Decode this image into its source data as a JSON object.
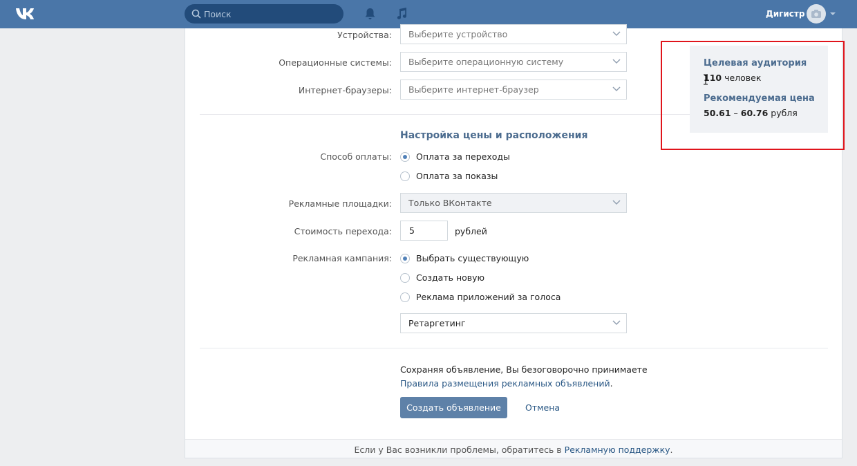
{
  "header": {
    "search_placeholder": "Поиск",
    "username": "Дигистр",
    "icons": [
      "vk-logo-icon",
      "search-icon",
      "bell-icon",
      "music-icon",
      "camera-icon",
      "caret-down-icon"
    ]
  },
  "targeting": {
    "devices_label": "Устройства:",
    "devices_placeholder": "Выберите устройство",
    "os_label": "Операционные системы:",
    "os_placeholder": "Выберите операционную систему",
    "browsers_label": "Интернет-браузеры:",
    "browsers_placeholder": "Выберите интернет-браузер"
  },
  "pricing": {
    "title": "Настройка цены и расположения",
    "payment_label": "Способ оплаты:",
    "payment_options": [
      {
        "label": "Оплата за переходы",
        "selected": true
      },
      {
        "label": "Оплата за показы",
        "selected": false
      }
    ],
    "platforms_label": "Рекламные площадки:",
    "platforms_value": "Только ВКонтакте",
    "cost_label": "Стоимость перехода:",
    "cost_value": "5",
    "cost_unit": "рублей",
    "campaign_label": "Рекламная кампания:",
    "campaign_options": [
      {
        "label": "Выбрать существующую",
        "selected": true
      },
      {
        "label": "Создать новую",
        "selected": false
      },
      {
        "label": "Реклама приложений за голоса",
        "selected": false
      }
    ],
    "campaign_value": "Ретаргетинг"
  },
  "submit": {
    "agree_text": "Сохраняя объявление, Вы безоговорочно принимаете",
    "rules_link": "Правила размещения рекламных объявлений",
    "rules_dot": ".",
    "create_button": "Создать объявление",
    "cancel_link": "Отмена"
  },
  "footer": {
    "text": "Если у Вас возникли проблемы, обратитесь в ",
    "link": "Рекламную поддержку",
    "dot": "."
  },
  "audience": {
    "title": "Целевая аудитория",
    "count": "110",
    "count_unit": " человек",
    "price_title": "Рекомендуемая цена",
    "price_min": "50.61",
    "price_sep": " – ",
    "price_max": "60.76",
    "price_unit": " рубля"
  },
  "colors": {
    "header": "#4a76a8",
    "accent": "#5181b8",
    "button": "#5e81a8",
    "highlight": "#e0141b"
  }
}
